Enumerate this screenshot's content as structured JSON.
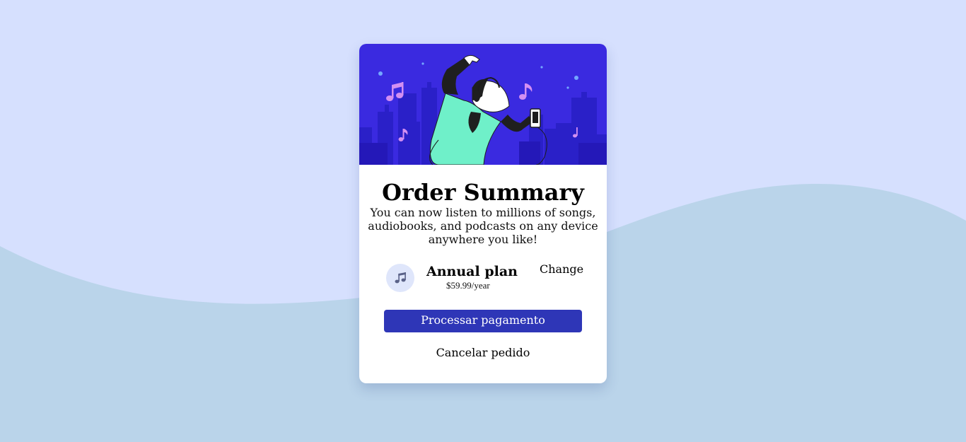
{
  "card": {
    "title": "Order Summary",
    "description": "You can now listen to millions of songs, audiobooks, and podcasts on any device anywhere you like!"
  },
  "plan": {
    "icon": "music-note-icon",
    "name": "Annual plan",
    "price": "$59.99/year",
    "change_label": "Change"
  },
  "actions": {
    "pay_label": "Processar pagamento",
    "cancel_label": "Cancelar pedido"
  },
  "hero": {
    "illustration": "person-dancing-with-headphones-illustration"
  },
  "colors": {
    "page_background": "#d6e0fe",
    "wave": "#bad4ea",
    "hero_background": "#3a2ae0",
    "primary_button": "#2e36b7",
    "plan_icon_background": "#dfe6fb"
  }
}
